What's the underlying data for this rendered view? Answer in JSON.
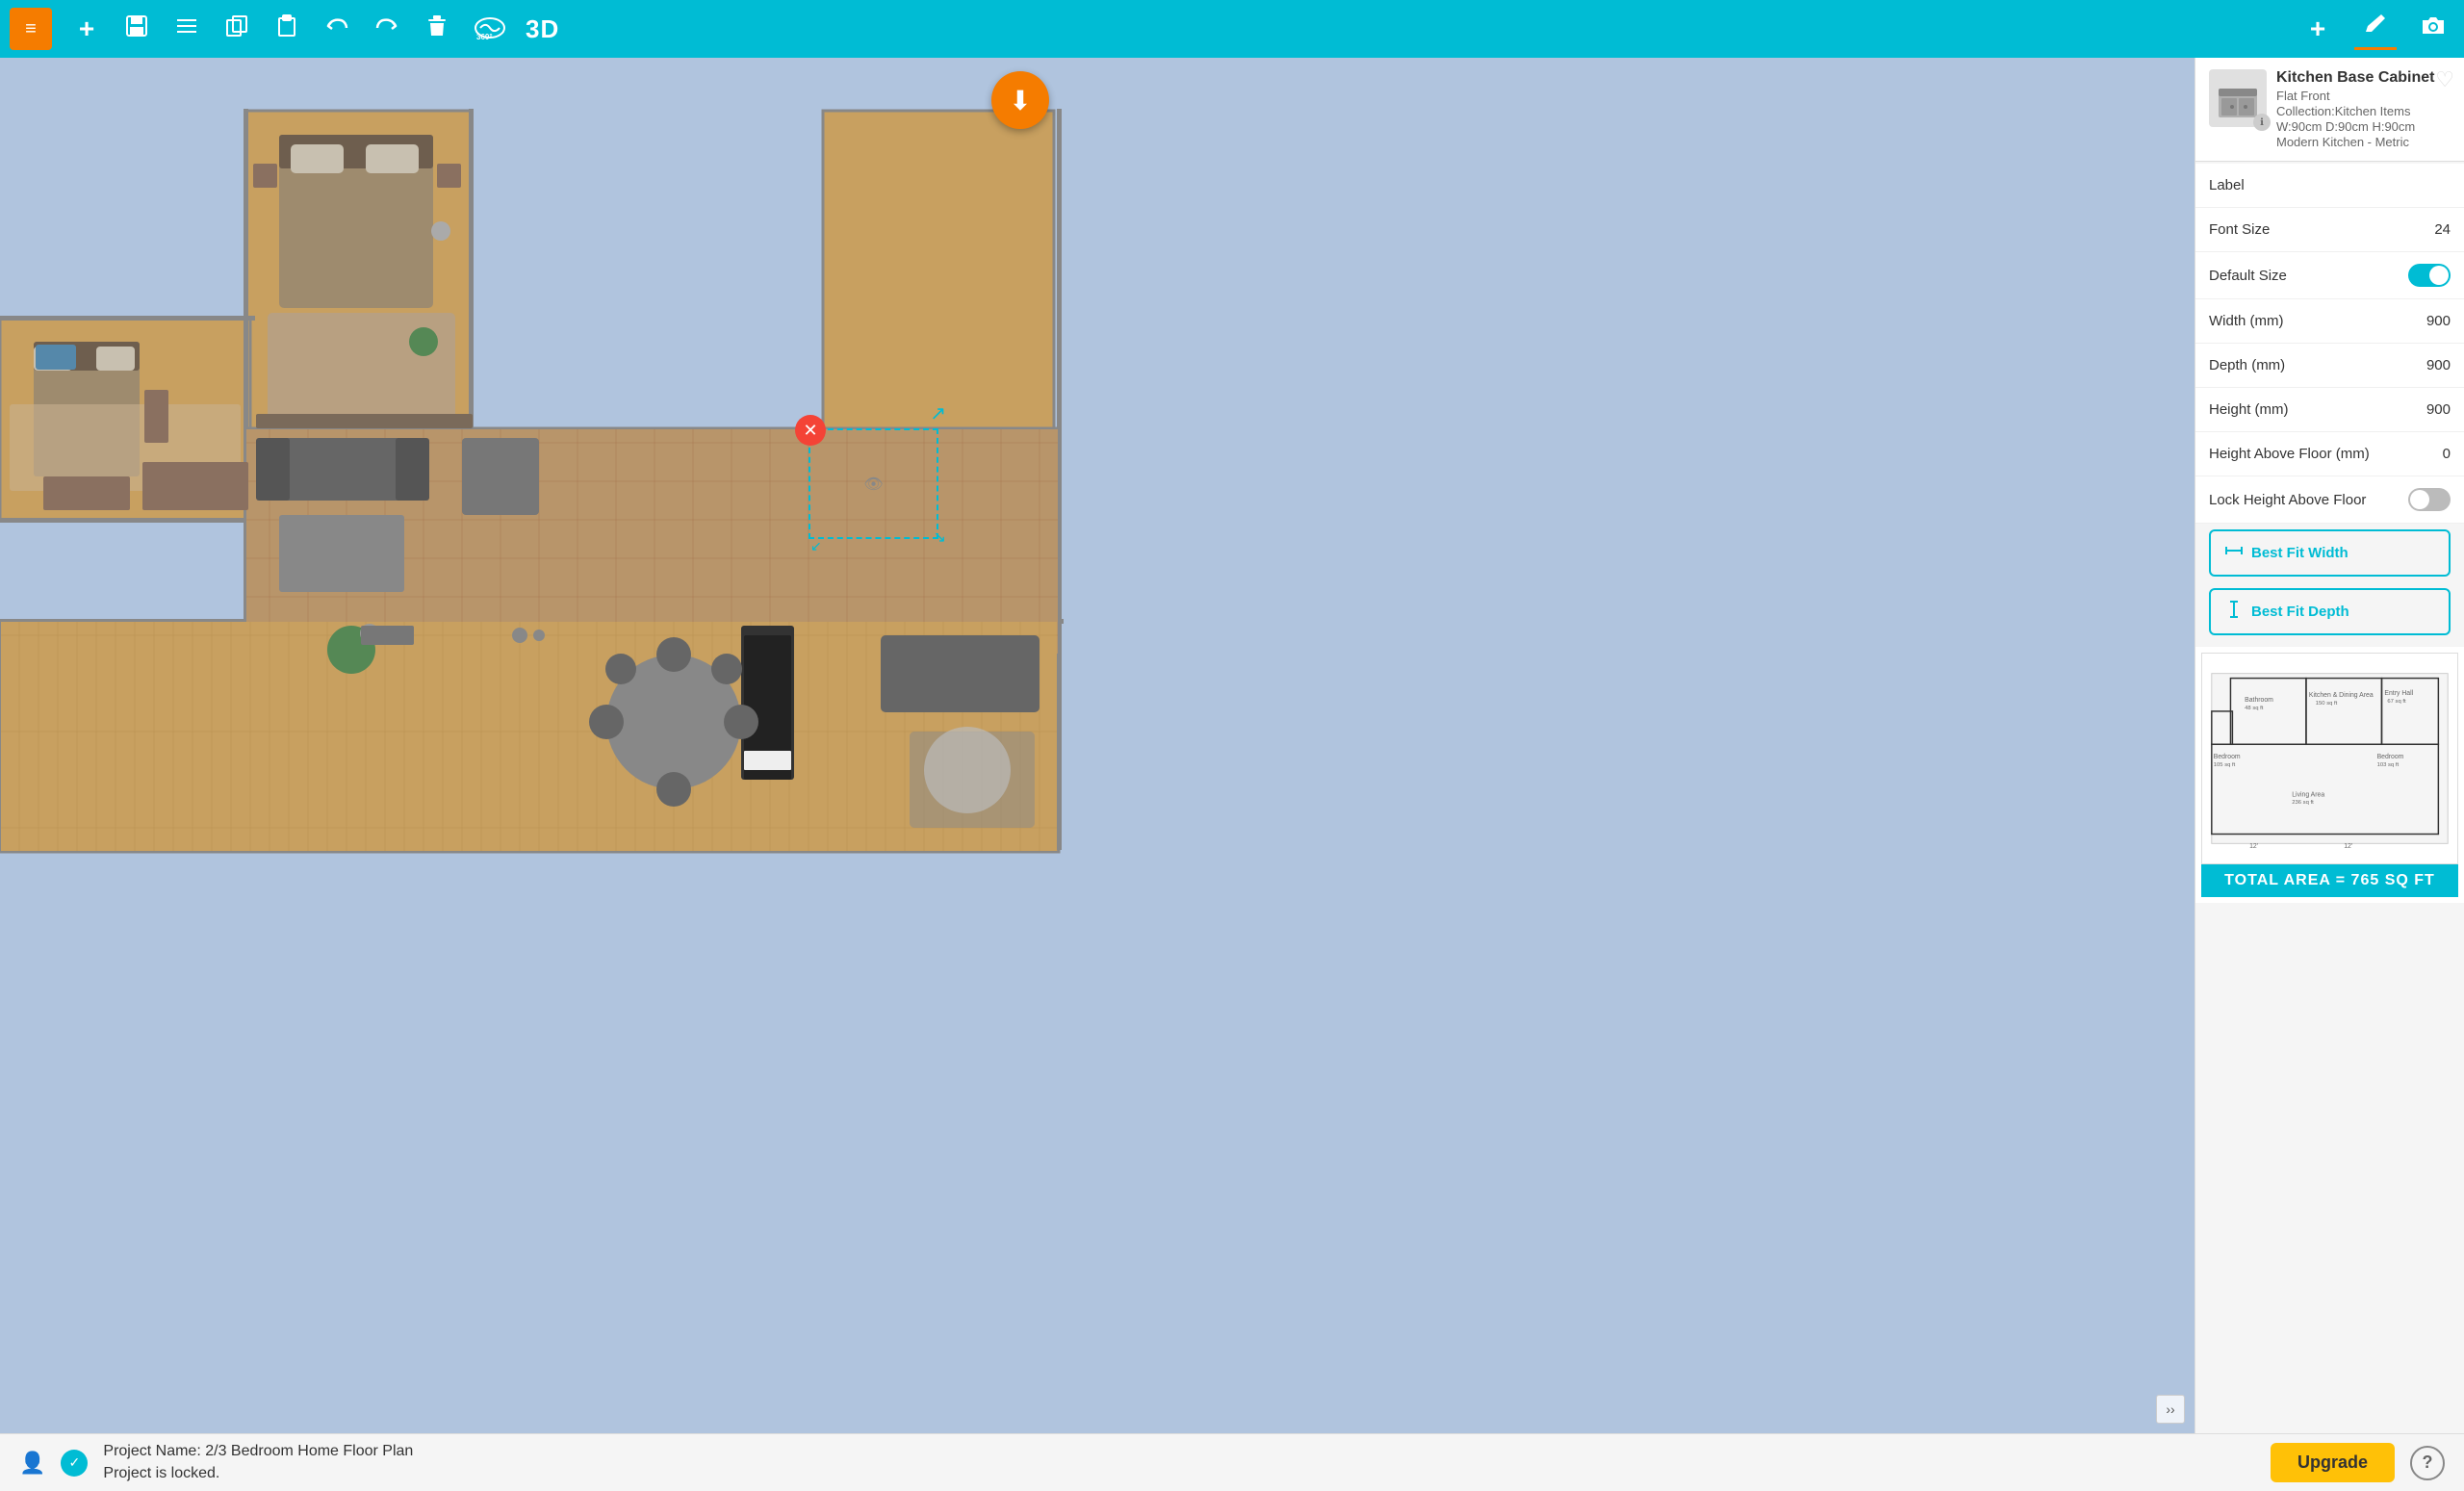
{
  "toolbar": {
    "menu_icon": "≡",
    "add_label": "+",
    "save_label": "💾",
    "undo_label": "↩",
    "redo_label": "↪",
    "delete_label": "🗑",
    "view360_label": "360°",
    "view3d_label": "3D",
    "add_right_label": "+",
    "pencil_label": "✏",
    "camera_label": "📷"
  },
  "object": {
    "name": "Kitchen Base Cabinet",
    "subtitle": "Flat Front",
    "collection": "Collection:Kitchen Items",
    "dims": "W:90cm D:90cm H:90cm",
    "style": "Modern Kitchen - Metric",
    "icon": "🗄"
  },
  "properties": {
    "label": {
      "name": "Label",
      "value": ""
    },
    "font_size": {
      "name": "Font Size",
      "value": "24"
    },
    "default_size": {
      "name": "Default Size",
      "value": "on"
    },
    "width_mm": {
      "name": "Width (mm)",
      "value": "900"
    },
    "depth_mm": {
      "name": "Depth (mm)",
      "value": "900"
    },
    "height_mm": {
      "name": "Height (mm)",
      "value": "900"
    },
    "height_above_floor": {
      "name": "Height Above Floor (mm)",
      "value": "0"
    },
    "lock_height": {
      "name": "Lock Height Above Floor",
      "value": "off"
    }
  },
  "best_fit_width": {
    "label": "Best Fit Width"
  },
  "best_fit_depth": {
    "label": "Best Fit Depth"
  },
  "minimap": {
    "total_area_label": "TOTAL AREA = 765 SQ FT"
  },
  "status": {
    "project_name_label": "Project Name: 2/3 Bedroom Home Floor Plan",
    "project_locked_label": "Project is locked.",
    "upgrade_label": "Upgrade",
    "help_label": "?"
  },
  "fab": {
    "download_icon": "⬇"
  }
}
